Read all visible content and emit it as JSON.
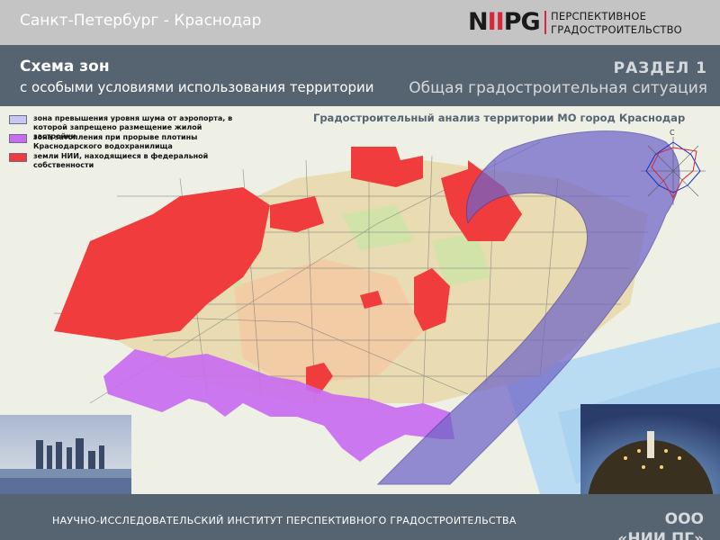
{
  "top_bar": {
    "route_title": "Санкт-Петербург - Краснодар",
    "logo_mark_n": "N",
    "logo_mark_ii": "II",
    "logo_mark_pg": "PG",
    "logo_line1": "ПЕРСПЕКТИВНОЕ",
    "logo_line2": "ГРАДОСТРОИТЕЛЬСТВО"
  },
  "header": {
    "title": "Схема зон",
    "subtitle": "с особыми условиями использования территории",
    "section_label": "РАЗДЕЛ 1",
    "section_name": "Общая градостроительная ситуация"
  },
  "map": {
    "heading": "Градостроительный анализ территории МО город Краснодар",
    "compass_north": "С",
    "legend": [
      {
        "text": "зона превышения уровня шума от аэропорта, в которой запрещено размещение жилой застройки",
        "color": "#c9c6ef"
      },
      {
        "text": "зона затопления при прорыве плотины Краснодарского водохранилища",
        "color": "#c86cf0"
      },
      {
        "text": "земли НИИ, находящиеся в федеральной собственности",
        "color": "#f03c3c"
      }
    ],
    "colors": {
      "noise_zone": "#6f64c8",
      "flood_zone": "#c86cf0",
      "federal_land": "#f03c3c",
      "water": "#b9dcf2",
      "urban": "#e8d8a8"
    }
  },
  "footer": {
    "institute": "НАУЧНО-ИССЛЕДОВАТЕЛЬСКИЙ ИНСТИТУТ ПЕРСПЕКТИВНОГО ГРАДОСТРОИТЕЛЬСТВА",
    "org_line1": "ООО",
    "org_line2": "«НИИ ПГ»"
  }
}
